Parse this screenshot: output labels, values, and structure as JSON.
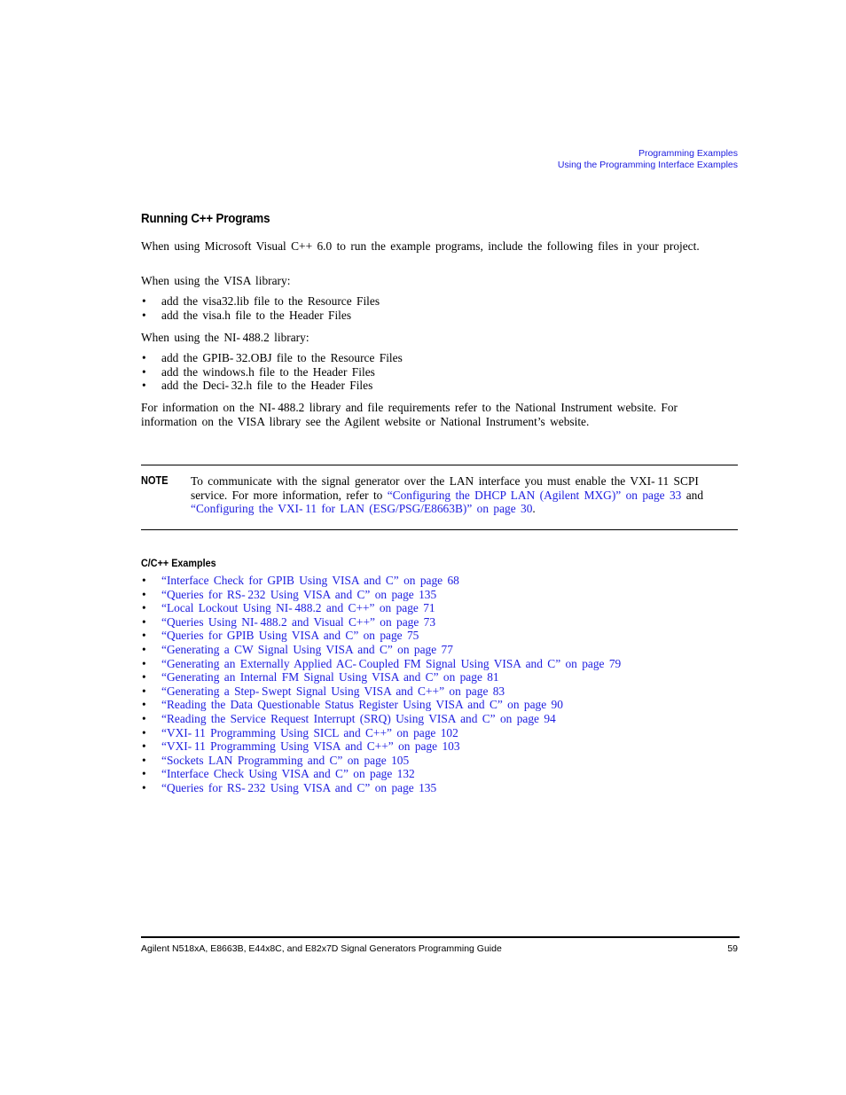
{
  "header": {
    "chapter": "Programming Examples",
    "section": "Using the Programming Interface Examples"
  },
  "section_title": "Running C++ Programs",
  "intro": "When using Microsoft Visual C++ 6.0 to run the example programs, include the following files in your project.",
  "visa": {
    "lead": "When using the VISA library:",
    "items": [
      "add the visa32.lib file to the Resource Files",
      "add the visa.h file to the Header Files"
    ]
  },
  "ni": {
    "lead": "When using the NI- 488.2 library:",
    "items": [
      "add the GPIB- 32.OBJ file to the Resource Files",
      "add the windows.h file to the Header Files",
      "add the Deci- 32.h file to the Header Files"
    ]
  },
  "info_paragraph": "For information on the NI- 488.2 library and file requirements refer to the National Instrument website. For information on the VISA library see the Agilent website or National Instrument’s website.",
  "note": {
    "label": "NOTE",
    "text_1": "To communicate with the signal generator over the LAN interface you must enable the VXI- 11 SCPI service. For more information, refer to ",
    "link_1": "“Configuring the DHCP LAN (Agilent MXG)” on page 33",
    "text_2": " and ",
    "link_2": "“Configuring the VXI- 11 for LAN (ESG/PSG/E8663B)” on page 30",
    "text_3": "."
  },
  "examples": {
    "title": "C/C++ Examples",
    "bullet": "•",
    "items": [
      "“Interface Check for GPIB Using VISA and C” on page 68",
      "“Queries for RS- 232 Using VISA and C” on page 135",
      "“Local Lockout Using NI- 488.2 and C++” on page 71",
      "“Queries Using NI- 488.2 and Visual C++” on page 73",
      "“Queries for GPIB Using VISA and C” on page 75",
      "“Generating a CW Signal Using VISA and C” on page 77",
      "“Generating an Externally Applied AC- Coupled FM Signal Using VISA and C” on page 79",
      "“Generating an Internal FM Signal Using VISA and C” on page 81",
      "“Generating a Step- Swept Signal Using VISA and C++” on page 83",
      "“Reading the Data Questionable Status Register Using VISA and C” on page 90",
      "“Reading the Service Request Interrupt (SRQ) Using VISA and C” on page 94",
      "“VXI- 11 Programming Using SICL and C++” on page 102",
      "“VXI- 11 Programming Using VISA and C++” on page 103",
      "“Sockets LAN Programming and C” on page 105",
      "“Interface Check Using VISA and C” on page 132",
      "“Queries for RS- 232 Using VISA and C” on page 135"
    ]
  },
  "footer": {
    "title": "Agilent N518xA, E8663B, E44x8C, and E82x7D Signal Generators Programming Guide",
    "page": "59"
  }
}
